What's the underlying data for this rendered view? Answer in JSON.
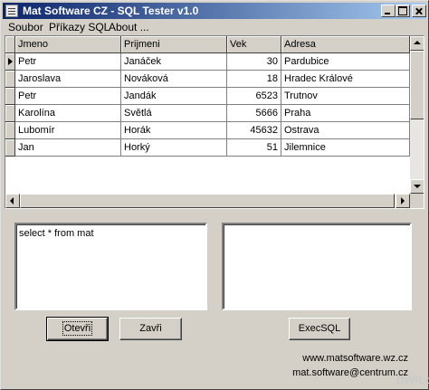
{
  "window": {
    "title": "Mat Software CZ - SQL Tester v1.0"
  },
  "menu": [
    {
      "label": "Soubor"
    },
    {
      "label": "Příkazy SQL"
    },
    {
      "label": "About ..."
    }
  ],
  "table": {
    "columns": [
      "Jmeno",
      "Prijmeni",
      "Vek",
      "Adresa"
    ],
    "rows": [
      {
        "jmeno": "Petr",
        "prijmeni": "Janáček",
        "vek": "30",
        "adresa": "Pardubice",
        "current": true
      },
      {
        "jmeno": "Jaroslava",
        "prijmeni": "Nováková",
        "vek": "18",
        "adresa": "Hradec Králové"
      },
      {
        "jmeno": "Petr",
        "prijmeni": "Jandák",
        "vek": "6523",
        "adresa": "Trutnov"
      },
      {
        "jmeno": "Karolína",
        "prijmeni": "Světlá",
        "vek": "5666",
        "adresa": "Praha"
      },
      {
        "jmeno": "Lubomír",
        "prijmeni": "Horák",
        "vek": "45632",
        "adresa": "Ostrava"
      },
      {
        "jmeno": "Jan",
        "prijmeni": "Horký",
        "vek": "51",
        "adresa": "Jilemnice"
      }
    ]
  },
  "sql_input": {
    "value": "select * from mat"
  },
  "result_output": {
    "value": ""
  },
  "buttons": {
    "open": "Otevři",
    "close": "Zavři",
    "exec": "ExecSQL"
  },
  "footer": {
    "website": "www.matsoftware.wz.cz",
    "email": "mat.software@centrum.cz"
  },
  "watermark": "DWR.cz",
  "colors": {
    "title_gradient_start": "#0a246a",
    "title_gradient_end": "#a6caf0",
    "face": "#d4d0c8"
  }
}
